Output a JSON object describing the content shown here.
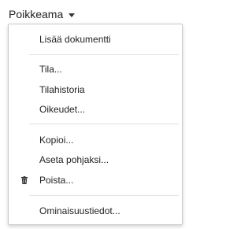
{
  "dropdown": {
    "label": "Poikkeama",
    "caret_icon": "caret-down-icon"
  },
  "menu": {
    "items": [
      {
        "label": "Lisää dokumentti"
      },
      {
        "label": "Tila..."
      },
      {
        "label": "Tilahistoria"
      },
      {
        "label": "Oikeudet..."
      },
      {
        "label": "Kopioi..."
      },
      {
        "label": "Aseta pohjaksi..."
      },
      {
        "label": "Poista...",
        "icon": "trash-icon"
      },
      {
        "label": "Ominaisuustiedot..."
      }
    ]
  },
  "colors": {
    "text": "#222222",
    "border": "#c9c9c9",
    "separator": "#e2e2e2"
  }
}
